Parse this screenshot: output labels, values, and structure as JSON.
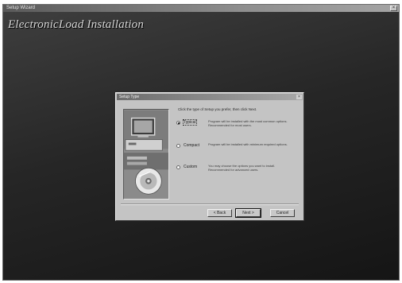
{
  "window": {
    "title": "Setup Wizard",
    "banner": "ElectronicLoad Installation"
  },
  "dialog": {
    "title": "Setup Type",
    "prompt": "Click the type of Setup you prefer, then click Next.",
    "options": [
      {
        "name": "Typical",
        "desc": "Program will be installed with the most common options. Recommended for most users.",
        "selected": true
      },
      {
        "name": "Compact",
        "desc": "Program will be installed with minimum required options.",
        "selected": false
      },
      {
        "name": "Custom",
        "desc": "You may choose the options you want to install. Recommended for advanced users.",
        "selected": false
      }
    ],
    "buttons": {
      "back": "< Back",
      "next": "Next >",
      "cancel": "Cancel"
    }
  }
}
